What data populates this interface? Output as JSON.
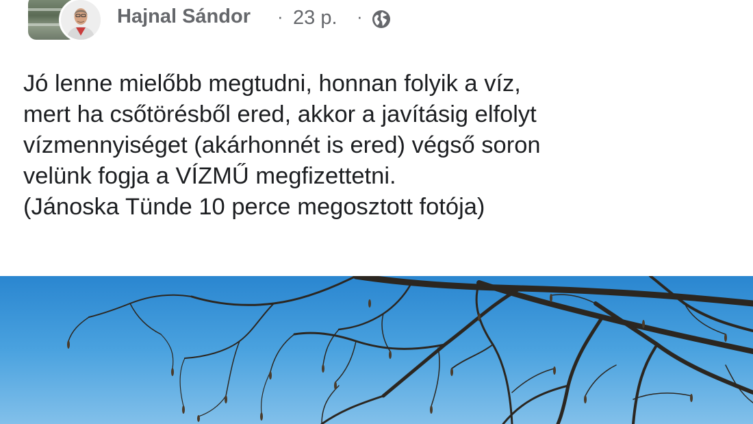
{
  "post": {
    "author": "Hajnal Sándor",
    "separator": "·",
    "time": "23 p.",
    "audience_icon": "globe-icon",
    "text_lines": [
      "Jó lenne mielőbb megtudni, honnan folyik a víz,",
      "mert ha csőtörésből ered, akkor a javításig elfolyt",
      "vízmennyiséget (akárhonnét is ered) végső soron",
      "velünk fogja a VÍZMŰ megfizettetni.",
      "(Jánoska Tünde 10 perce megosztott fotója)"
    ]
  },
  "colors": {
    "meta_text": "#65676b",
    "body_text": "#1c1e21",
    "sky": "#3c98dc",
    "branches": "#2b2620"
  }
}
